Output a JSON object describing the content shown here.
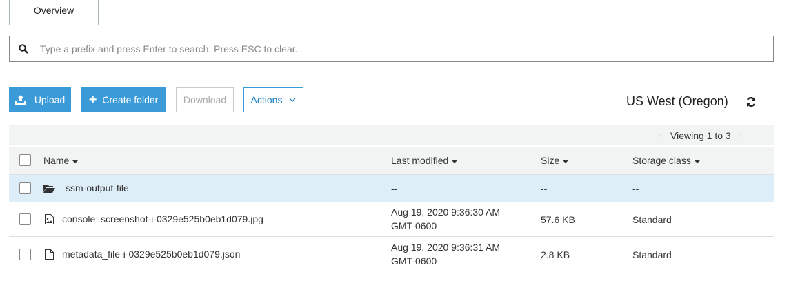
{
  "tabs": [
    {
      "label": "Overview"
    }
  ],
  "search": {
    "placeholder": "Type a prefix and press Enter to search. Press ESC to clear."
  },
  "toolbar": {
    "upload": "Upload",
    "create_folder": "Create folder",
    "download": "Download",
    "actions": "Actions"
  },
  "region": "US West (Oregon)",
  "pagination": {
    "text": "Viewing 1 to 3"
  },
  "columns": {
    "name": "Name",
    "last_modified": "Last modified",
    "size": "Size",
    "storage_class": "Storage class"
  },
  "rows": [
    {
      "name": "ssm-output-file",
      "type": "folder",
      "date": "--",
      "size": "--",
      "storage": "--"
    },
    {
      "name": "console_screenshot-i-0329e525b0eb1d079.jpg",
      "type": "image",
      "date": "Aug 19, 2020 9:36:30 AM",
      "tz": "GMT-0600",
      "size": "57.6 KB",
      "storage": "Standard"
    },
    {
      "name": "metadata_file-i-0329e525b0eb1d079.json",
      "type": "file",
      "date": "Aug 19, 2020 9:36:31 AM",
      "tz": "GMT-0600",
      "size": "2.8 KB",
      "storage": "Standard"
    }
  ]
}
